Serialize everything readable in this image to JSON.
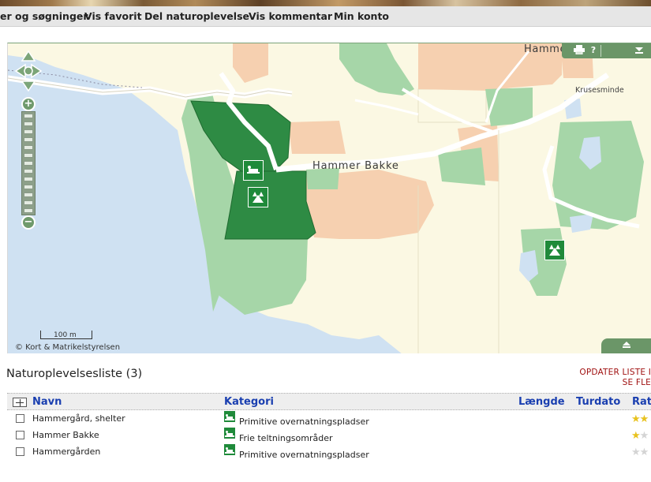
{
  "nav": {
    "items": [
      "er og søgninger",
      "Vis favorit",
      "Del naturoplevelse",
      "Vis kommentar",
      "Min konto"
    ]
  },
  "map": {
    "place_labels": {
      "hammer_bakke": "Hammer  Bakke",
      "hammer": "Hammer",
      "krusesminde": "Krusesminde"
    },
    "scale_label": "100 m",
    "copyright": "© Kort & Matrikelstyrelsen",
    "tools": {
      "print": "print-icon",
      "help": "?",
      "collapse": "chevron-down-icon"
    },
    "colors": {
      "water": "#cfe1f2",
      "land": "#fbf8e3",
      "forest": "#a6d6a8",
      "selected_area": "#2e8b44",
      "poi": "#1f8a3a"
    }
  },
  "list": {
    "title": "Naturoplevelsesliste (3)",
    "update_link": "OPDATER LISTE I\nSE FLE",
    "columns": {
      "name": "Navn",
      "category": "Kategori",
      "length": "Længde",
      "trip_date": "Turdato",
      "rating": "Rat"
    },
    "rows": [
      {
        "name": "Hammergård, shelter",
        "category": "Primitive overnatningspladser",
        "rating": 2
      },
      {
        "name": "Hammer Bakke",
        "category": "Frie teltningsområder",
        "rating": 1
      },
      {
        "name": "Hammergården",
        "category": "Primitive overnatningspladser",
        "rating": 0
      }
    ]
  }
}
